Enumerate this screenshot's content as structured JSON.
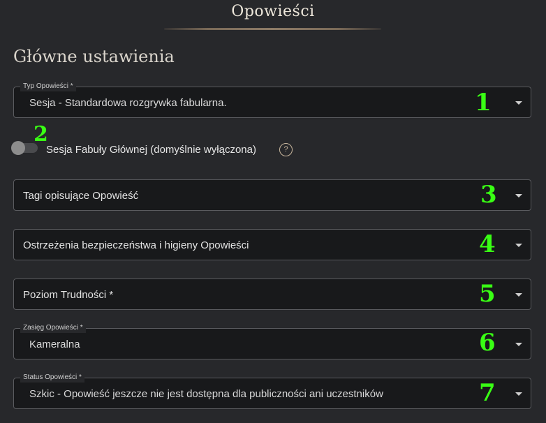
{
  "header": {
    "title": "Opowieści"
  },
  "section": {
    "title": "Główne ustawienia"
  },
  "fields": [
    {
      "label": "Typ Opowieści *",
      "value": "Sesja - Standardowa rozgrywka fabularna.",
      "marker": "1"
    },
    {
      "label": "",
      "value": "Tagi opisujące Opowieść",
      "marker": "3"
    },
    {
      "label": "",
      "value": "Ostrzeżenia bezpieczeństwa i higieny Opowieści",
      "marker": "4"
    },
    {
      "label": "",
      "value": "Poziom Trudności *",
      "marker": "5"
    },
    {
      "label": "Zasięg Opowieści *",
      "value": "Kameralna",
      "marker": "6"
    },
    {
      "label": "Status Opowieści *",
      "value": "Szkic - Opowieść jeszcze nie jest dostępna dla publiczności ani uczestników",
      "marker": "7"
    }
  ],
  "toggle": {
    "label": "Sesja Fabuły Głównej (domyślnie wyłączona)",
    "marker": "2",
    "help_icon": "?",
    "state": "off"
  },
  "colors": {
    "background": "#27282b",
    "field": "#18191b",
    "marker": "#39ff14",
    "accent": "#c9b79d"
  }
}
